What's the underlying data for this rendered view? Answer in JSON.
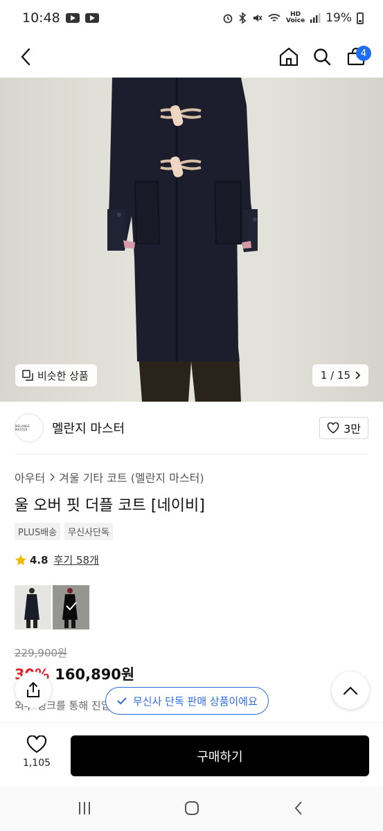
{
  "status_bar": {
    "time": "10:48",
    "hd_label_top": "HD",
    "hd_label_bottom": "Voice",
    "battery": "19%"
  },
  "top_nav": {
    "cart_count": "4",
    "icons": [
      "back-arrow-icon",
      "home-icon",
      "search-icon",
      "cart-icon"
    ]
  },
  "hero": {
    "similar_label": "비슷한 상품",
    "counter": "1 / 15"
  },
  "brand": {
    "logo_text": "MELANGE MASTER",
    "name": "멜란지 마스터",
    "likes": "3만"
  },
  "product": {
    "breadcrumb": [
      "아우터",
      "겨울 기타 코트 (멜란지 마스터)"
    ],
    "title": "울 오버 핏 더플 코트 [네이비]",
    "tags": [
      "PLUS배송",
      "무신사단독"
    ],
    "rating": "4.8",
    "reviews": "후기 58개",
    "original_price": "229,900원",
    "discount": "30%",
    "sale_price": "160,890원",
    "notice": "외부 링크를 통해 진입 시 일부 할인이 제한될 수 있습니다"
  },
  "toast": {
    "label": "무신사 단독 판매 상품이에요"
  },
  "bottom_bar": {
    "like_count": "1,105",
    "buy_label": "구매하기"
  },
  "colors": {
    "accent_blue": "#1e6ef4",
    "discount_red": "#e2232a",
    "coat_navy": "#1c1e2e"
  }
}
